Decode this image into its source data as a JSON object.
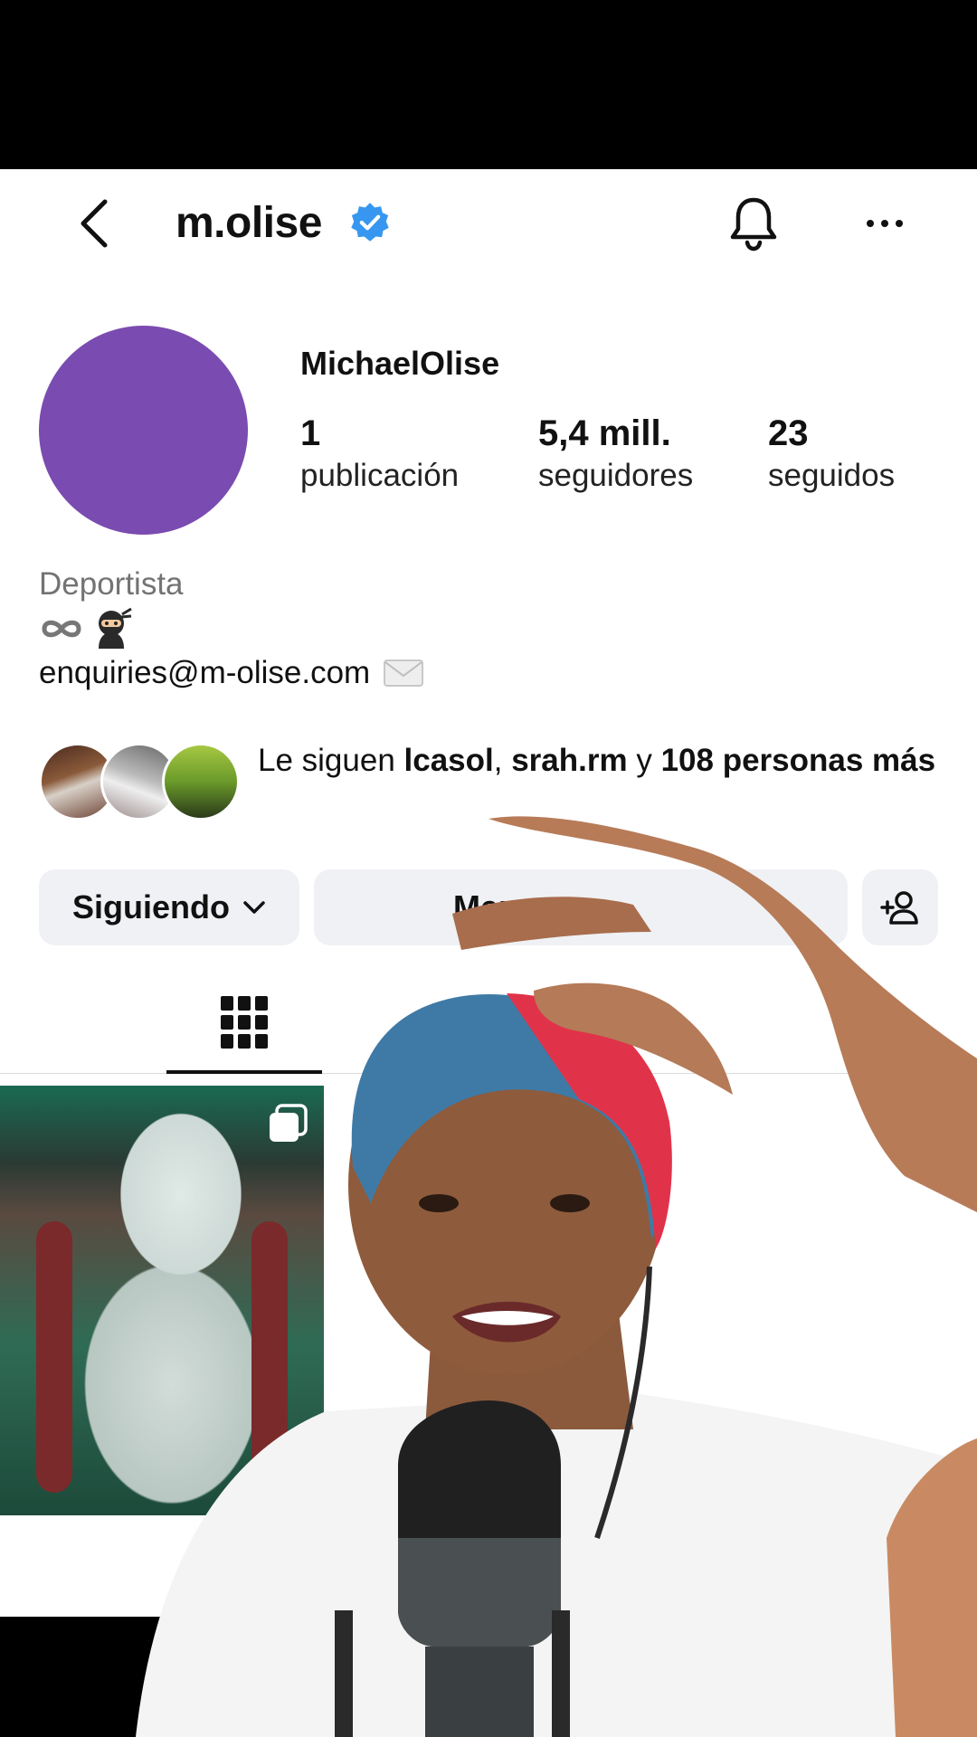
{
  "header": {
    "username": "m.olise"
  },
  "profile": {
    "display_name": "MichaelOlise",
    "stats": {
      "posts_value": "1",
      "posts_label": "publicación",
      "followers_value": "5,4 mill.",
      "followers_label": "seguidores",
      "following_value": "23",
      "following_label": "seguidos"
    },
    "category": "Deportista",
    "bio_line1": "∞🥷",
    "email": "enquiries@m-olise.com",
    "email_emoji": "✉️"
  },
  "followed_by": {
    "prefix": "Le siguen ",
    "user1": "lcasol",
    "sep": ", ",
    "user2": "srah.rm",
    "conj": " y ",
    "others": "108 personas más"
  },
  "actions": {
    "following_label": "Siguiendo",
    "message_label": "Mensa"
  },
  "icons": {
    "back": "chevron-left-icon",
    "verified": "verified-badge-icon",
    "bell": "bell-icon",
    "more": "more-horizontal-icon",
    "grid": "grid-icon",
    "add_user": "add-person-icon",
    "carousel": "multiple-posts-icon"
  },
  "colors": {
    "verified_blue": "#3797f0",
    "avatar_purple": "#7a4bb0",
    "button_bg": "#eff1f4",
    "muted_text": "#737373"
  }
}
